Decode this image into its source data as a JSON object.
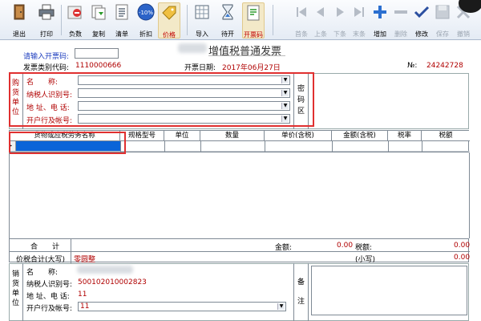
{
  "toolbar": {
    "exit": "退出",
    "print": "打印",
    "negative": "负数",
    "copy": "复制",
    "list": "清单",
    "discount": "折扣",
    "discount_badge": "-10%",
    "price": "价格",
    "import": "导入",
    "pending": "待开",
    "issue_code": "开票码",
    "first": "首条",
    "prev": "上条",
    "next": "下条",
    "last": "末条",
    "add": "增加",
    "delete": "删除",
    "modify": "修改",
    "save": "保存",
    "cancel": "撤销"
  },
  "title": "增值税普通发票",
  "header": {
    "input_code_label": "请输入开票码:",
    "input_code_value": "",
    "invoice_code_label": "发票类别代码:",
    "invoice_code": "1110000666",
    "date_label": "开票日期:",
    "date": "2017年06月27日",
    "no_label": "№:",
    "no": "24242728"
  },
  "buyer": {
    "side_label": "购货单位",
    "name_label": "名　　称:",
    "taxid_label": "纳税人识别号:",
    "addr_label": "地 址、电 话:",
    "bank_label": "开户行及帐号:",
    "name": "",
    "taxid": "",
    "addr": "",
    "bank": "",
    "cipher_label": "密码区"
  },
  "items": {
    "columns": [
      "货物或应税劳务名称",
      "规格型号",
      "单位",
      "数量",
      "单价(含税)",
      "金额(含税)",
      "税率",
      "税额"
    ]
  },
  "totals": {
    "total_label": "合　　计",
    "amount_label": "金额:",
    "amount": "0.00",
    "tax_label": "税额:",
    "tax": "0.00",
    "price_tax_label": "价税合计(大写)",
    "price_tax_words": "零圆整",
    "small_label": "(小写)",
    "small_value": "0.00"
  },
  "seller": {
    "side_label": "销货单位",
    "name_label": "名　　称:",
    "taxid_label": "纳税人识别号:",
    "addr_label": "地 址、电 话:",
    "bank_label": "开户行及帐号:",
    "taxid": "500102010002823",
    "addr": "11",
    "bank": "11",
    "remark_label": "备注"
  },
  "colors": {
    "label_red": "#b00000",
    "label_blue": "#1f3fbf",
    "highlight": "#e03030",
    "selection": "#0a64d8"
  }
}
